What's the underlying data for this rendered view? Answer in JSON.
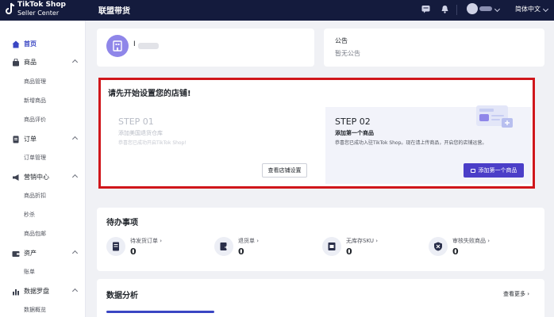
{
  "app": {
    "logo_line1": "TikTok Shop",
    "logo_line2": "Seller Center",
    "nav_title": "联盟带货",
    "language": "简体中文",
    "accent_color": "#3a46c3",
    "topbar_color": "#141b3d"
  },
  "sidebar": {
    "items": [
      {
        "label": "首页",
        "icon": "home-icon"
      },
      {
        "label": "商品",
        "icon": "bag-icon"
      },
      {
        "label": "商品管理"
      },
      {
        "label": "新增商品"
      },
      {
        "label": "商品评价"
      },
      {
        "label": "订单",
        "icon": "order-icon"
      },
      {
        "label": "订单管理"
      },
      {
        "label": "营销中心",
        "icon": "megaphone-icon"
      },
      {
        "label": "商品折扣"
      },
      {
        "label": "秒杀"
      },
      {
        "label": "商品包邮"
      },
      {
        "label": "资产",
        "icon": "wallet-icon"
      },
      {
        "label": "账单"
      },
      {
        "label": "数据罗盘",
        "icon": "chart-icon"
      },
      {
        "label": "数据概览"
      }
    ]
  },
  "shop": {
    "name": "I"
  },
  "notice": {
    "title": "公告",
    "empty_text": "暂无公告"
  },
  "setup": {
    "title": "请先开始设置您的店铺!",
    "step1": {
      "number": "STEP 01",
      "heading": "添加美国退货仓库",
      "description": "恭喜您已成功开启TikTok Shop!",
      "button": "查看店铺设置"
    },
    "step2": {
      "number": "STEP 02",
      "heading": "添加第一个商品",
      "description": "恭喜您已成功入驻TikTok Shop。现在请上传商品，开启您的店铺运营。",
      "button": "添加第一个商品"
    },
    "highlight_color": "#d0161b"
  },
  "todo": {
    "title": "待办事项",
    "items": [
      {
        "label": "待发货订单 ›",
        "count": "0",
        "icon": "order-doc-icon"
      },
      {
        "label": "退货单 ›",
        "count": "0",
        "icon": "return-icon"
      },
      {
        "label": "无库存SKU ›",
        "count": "0",
        "icon": "stock-icon"
      },
      {
        "label": "审核失败商品 ›",
        "count": "0",
        "icon": "review-failed-icon"
      }
    ]
  },
  "analysis": {
    "title": "数据分析",
    "more": "查看更多 ›"
  }
}
